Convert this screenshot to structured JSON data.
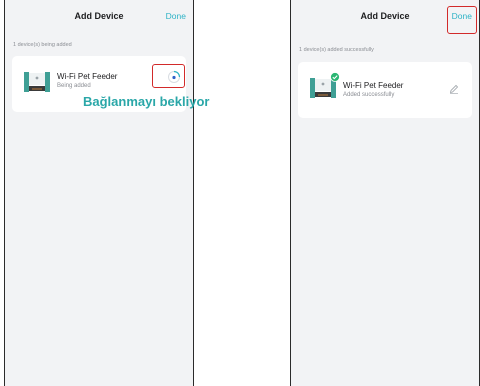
{
  "left_screen": {
    "title": "Add Device",
    "done_label": "Done",
    "status": "1 device(s) being added",
    "device": {
      "name": "Wi-Fi Pet Feeder",
      "status": "Being added",
      "action_icon": "loading-spinner-icon"
    }
  },
  "right_screen": {
    "title": "Add Device",
    "done_label": "Done",
    "status": "1 device(s) added successfully",
    "device": {
      "name": "Wi-Fi Pet Feeder",
      "status": "Added successfully",
      "action_icon": "edit-pencil-icon",
      "badge_icon": "success-check-icon"
    }
  },
  "annotation": "Bağlanmayı bekliyor",
  "colors": {
    "accent": "#2fb3c6",
    "highlight": "#d22a2a",
    "annotation": "#2aa7a8",
    "success": "#2bb673"
  }
}
